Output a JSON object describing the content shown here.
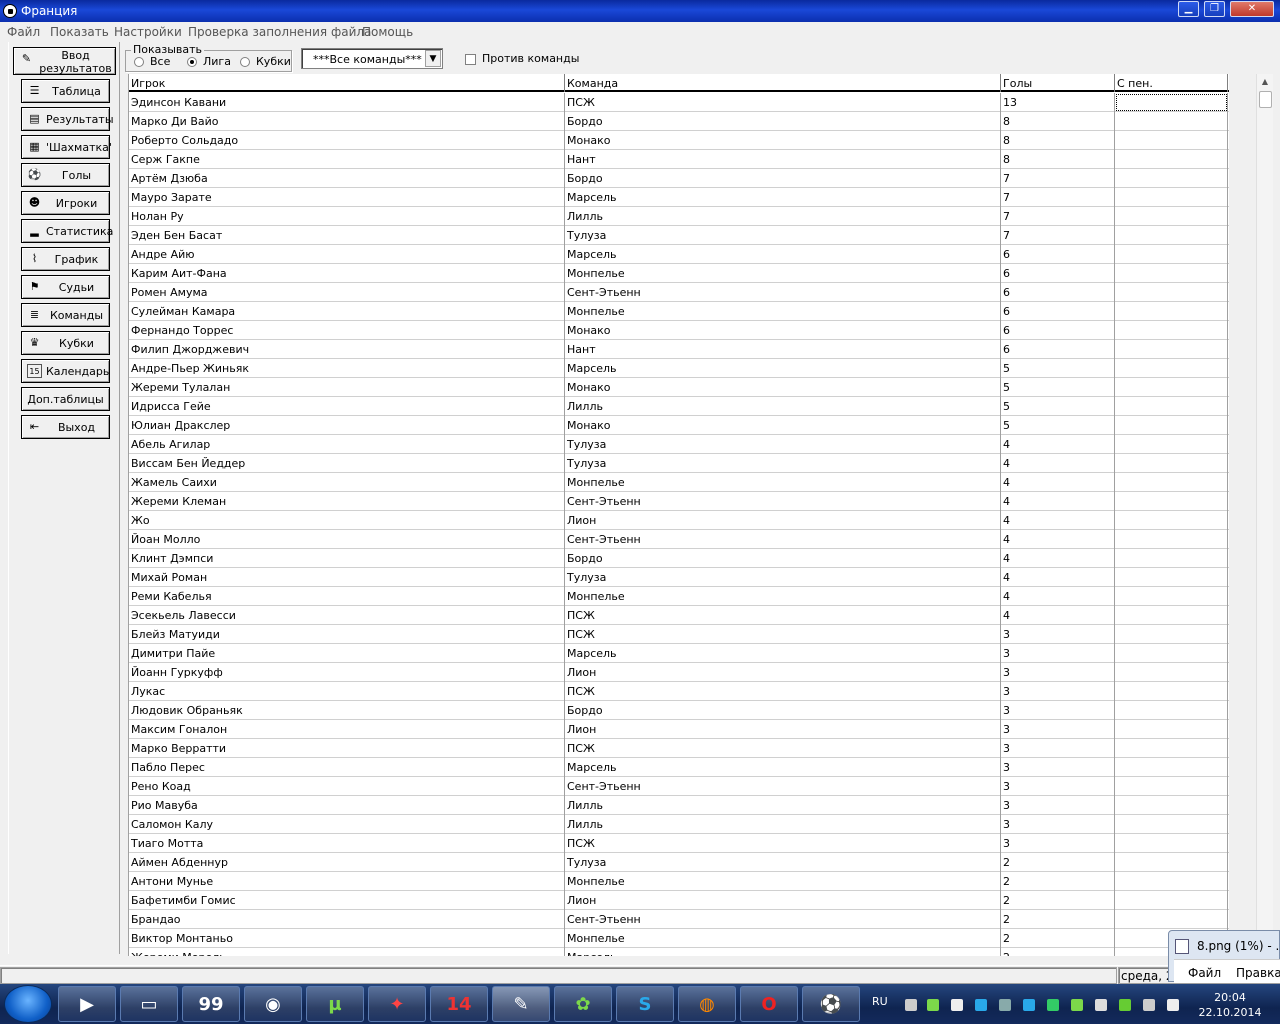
{
  "window": {
    "title": "Франция"
  },
  "menu": [
    "Файл",
    "Показать",
    "Настройки",
    "Проверка заполнения файла",
    "Помощь"
  ],
  "sidebar": [
    {
      "label": "Ввод результатов",
      "icon": "edit-icon"
    },
    {
      "label": "Таблица",
      "icon": "list-icon"
    },
    {
      "label": "Результаты",
      "icon": "results-icon"
    },
    {
      "label": "'Шахматка'",
      "icon": "grid-icon"
    },
    {
      "label": "Голы",
      "icon": "ball-icon"
    },
    {
      "label": "Игроки",
      "icon": "players-icon"
    },
    {
      "label": "Статистика",
      "icon": "stats-icon"
    },
    {
      "label": "График",
      "icon": "graph-icon"
    },
    {
      "label": "Судьи",
      "icon": "referee-icon"
    },
    {
      "label": "Команды",
      "icon": "teams-icon"
    },
    {
      "label": "Кубки",
      "icon": "cup-icon"
    },
    {
      "label": "Календарь",
      "icon": "calendar-icon"
    },
    {
      "label": "Доп.таблицы",
      "icon": ""
    },
    {
      "label": "Выход",
      "icon": "exit-icon"
    }
  ],
  "filter": {
    "group_label": "Показывать",
    "options": [
      "Все",
      "Лига",
      "Кубки"
    ],
    "selected": "Лига",
    "team_select": "***Все команды***",
    "against_label": "Против команды"
  },
  "table": {
    "columns": [
      "Игрок",
      "Команда",
      "Голы",
      "С пен."
    ],
    "rows": [
      [
        "Эдинсон Кавани",
        "ПСЖ",
        "13",
        ""
      ],
      [
        "Марко Ди Вайо",
        "Бордо",
        "8",
        ""
      ],
      [
        "Роберто Сольдадо",
        "Монако",
        "8",
        ""
      ],
      [
        "Серж Гакпе",
        "Нант",
        "8",
        ""
      ],
      [
        "Артём Дзюба",
        "Бордо",
        "7",
        ""
      ],
      [
        "Мауро Зарате",
        "Марсель",
        "7",
        ""
      ],
      [
        "Нолан Ру",
        "Лилль",
        "7",
        ""
      ],
      [
        "Эден Бен Басат",
        "Тулуза",
        "7",
        ""
      ],
      [
        "Андре Айю",
        "Марсель",
        "6",
        ""
      ],
      [
        "Карим Аит-Фана",
        "Монпелье",
        "6",
        ""
      ],
      [
        "Ромен Амума",
        "Сент-Этьенн",
        "6",
        ""
      ],
      [
        "Сулейман Камара",
        "Монпелье",
        "6",
        ""
      ],
      [
        "Фернандо Торрес",
        "Монако",
        "6",
        ""
      ],
      [
        "Филип Джорджевич",
        "Нант",
        "6",
        ""
      ],
      [
        "Андре-Пьер Жиньяк",
        "Марсель",
        "5",
        ""
      ],
      [
        "Жереми Тулалан",
        "Монако",
        "5",
        ""
      ],
      [
        "Идрисса Гейе",
        "Лилль",
        "5",
        ""
      ],
      [
        "Юлиан Драксле​р",
        "Монако",
        "5",
        ""
      ],
      [
        "Абель Агилар",
        "Тулуза",
        "4",
        ""
      ],
      [
        "Виссам Бен Йеддер",
        "Тулуза",
        "4",
        ""
      ],
      [
        "Жамель Саихи",
        "Монпелье",
        "4",
        ""
      ],
      [
        "Жереми Клеман",
        "Сент-Этьенн",
        "4",
        ""
      ],
      [
        "Жо",
        "Лион",
        "4",
        ""
      ],
      [
        "Йоан Молло",
        "Сент-Этьенн",
        "4",
        ""
      ],
      [
        "Клинт Дэмпси",
        "Бордо",
        "4",
        ""
      ],
      [
        "Михай Роман",
        "Тулуза",
        "4",
        ""
      ],
      [
        "Реми Кабелья",
        "Монпелье",
        "4",
        ""
      ],
      [
        "Эсекьель Лавесси",
        "ПСЖ",
        "4",
        ""
      ],
      [
        "Блейз Матуиди",
        "ПСЖ",
        "3",
        ""
      ],
      [
        "Димитри Пайе",
        "Марсель",
        "3",
        ""
      ],
      [
        "Йоанн Гуркуфф",
        "Лион",
        "3",
        ""
      ],
      [
        "Лукас",
        "ПСЖ",
        "3",
        ""
      ],
      [
        "Людовик Обраньяк",
        "Бордо",
        "3",
        ""
      ],
      [
        "Максим Гоналон",
        "Лион",
        "3",
        ""
      ],
      [
        "Марко Верратти",
        "ПСЖ",
        "3",
        ""
      ],
      [
        "Пабло Перес",
        "Марсель",
        "3",
        ""
      ],
      [
        "Рено Коад",
        "Сент-Этьенн",
        "3",
        ""
      ],
      [
        "Рио Мавуба",
        "Лилль",
        "3",
        ""
      ],
      [
        "Саломон Калу",
        "Лилль",
        "3",
        ""
      ],
      [
        "Тиаго Мотта",
        "ПСЖ",
        "3",
        ""
      ],
      [
        "Аймен Абденнур",
        "Тулуза",
        "2",
        ""
      ],
      [
        "Антони Мунье",
        "Монпелье",
        "2",
        ""
      ],
      [
        "Бафетимби Гомис",
        "Лион",
        "2",
        ""
      ],
      [
        "Брандао",
        "Сент-Этьенн",
        "2",
        ""
      ],
      [
        "Виктор Монтаньо",
        "Монпелье",
        "2",
        ""
      ],
      [
        "Жереми Морель",
        "Марсель",
        "2",
        ""
      ]
    ]
  },
  "status": {
    "text": "среда, 2"
  },
  "popup": {
    "title": "8.png (1%) - ...",
    "menu": [
      "Файл",
      "Правка"
    ]
  },
  "taskbar": {
    "lang": "RU",
    "time": "20:04",
    "date": "22.10.2014",
    "apps": [
      "media-player-icon",
      "file-explorer-icon",
      "monitor-icon",
      "camera-icon",
      "utorrent-icon",
      "pinnacle-icon",
      "14-icon",
      "paint-icon",
      "icq-icon",
      "skype-icon",
      "firefox-icon",
      "opera-icon",
      "football-app-icon"
    ],
    "app_text": {
      "fourteen": "14",
      "skype": "S",
      "utorrent": "µ",
      "opera": "O",
      "monitor": "99"
    }
  }
}
